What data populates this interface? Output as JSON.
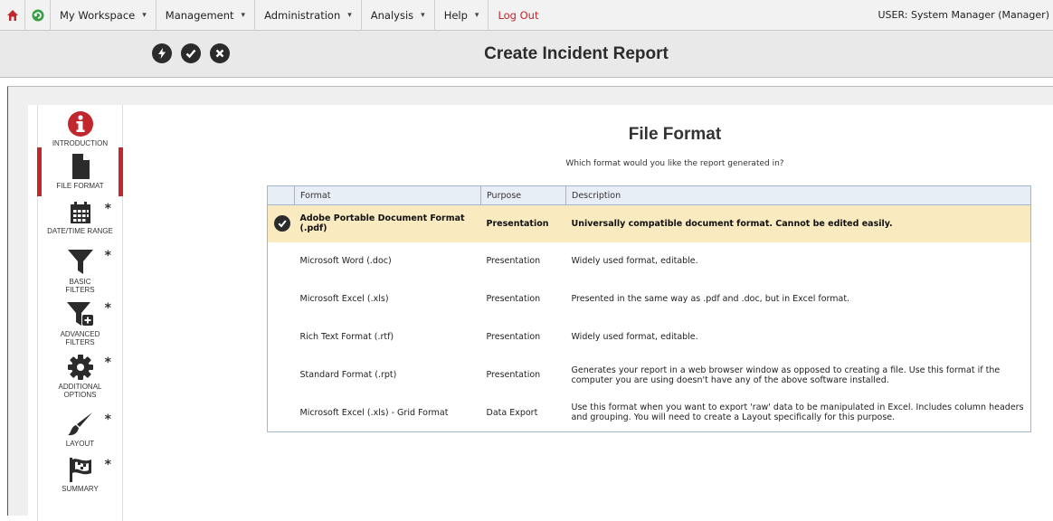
{
  "menubar": {
    "items": [
      {
        "label": "My Workspace",
        "caret": "▾"
      },
      {
        "label": "Management",
        "caret": "▾"
      },
      {
        "label": "Administration",
        "caret": "▾"
      },
      {
        "label": "Analysis",
        "caret": "▾"
      },
      {
        "label": "Help",
        "caret": "▾"
      }
    ],
    "logout": "Log Out",
    "user": "USER: System Manager (Manager)"
  },
  "header": {
    "title": "Create Incident Report"
  },
  "sidebar": {
    "steps": [
      {
        "label": "INTRODUCTION",
        "icon": "info-icon",
        "required": false
      },
      {
        "label": "FILE FORMAT",
        "icon": "file-icon",
        "required": false
      },
      {
        "label": "DATE/TIME RANGE",
        "icon": "calendar-icon",
        "required": true
      },
      {
        "label": "BASIC\nFILTERS",
        "icon": "filter-icon",
        "required": true
      },
      {
        "label": "ADVANCED\nFILTERS",
        "icon": "filter-plus-icon",
        "required": true
      },
      {
        "label": "ADDITIONAL\nOPTIONS",
        "icon": "gear-icon",
        "required": true
      },
      {
        "label": "LAYOUT",
        "icon": "brush-icon",
        "required": true
      },
      {
        "label": "SUMMARY",
        "icon": "flag-icon",
        "required": true
      }
    ],
    "star": "*"
  },
  "main": {
    "title": "File Format",
    "subtitle": "Which format would you like the report generated in?",
    "columns": [
      "Format",
      "Purpose",
      "Description"
    ],
    "rows": [
      {
        "format": "Adobe Portable Document Format (.pdf)",
        "purpose": "Presentation",
        "description": "Universally compatible document format. Cannot be edited easily.",
        "selected": true
      },
      {
        "format": "Microsoft Word (.doc)",
        "purpose": "Presentation",
        "description": "Widely used format, editable.",
        "selected": false
      },
      {
        "format": "Microsoft Excel (.xls)",
        "purpose": "Presentation",
        "description": "Presented in the same way as .pdf and .doc, but in Excel format.",
        "selected": false
      },
      {
        "format": "Rich Text Format (.rtf)",
        "purpose": "Presentation",
        "description": "Widely used format, editable.",
        "selected": false
      },
      {
        "format": "Standard Format (.rpt)",
        "purpose": "Presentation",
        "description": "Generates your report in a web browser window as opposed to creating a file. Use this format if the computer you are using doesn't have any of the above software installed.",
        "selected": false
      },
      {
        "format": "Microsoft Excel (.xls) - Grid Format",
        "purpose": "Data Export",
        "description": "Use this format when you want to export 'raw' data to be manipulated in Excel. Includes column headers and grouping. You will need to create a Layout specifically for this purpose.",
        "selected": false
      }
    ]
  },
  "colors": {
    "accent": "#c0282d",
    "selected_row": "#faeac0",
    "grid_border": "#9fb7cf"
  }
}
